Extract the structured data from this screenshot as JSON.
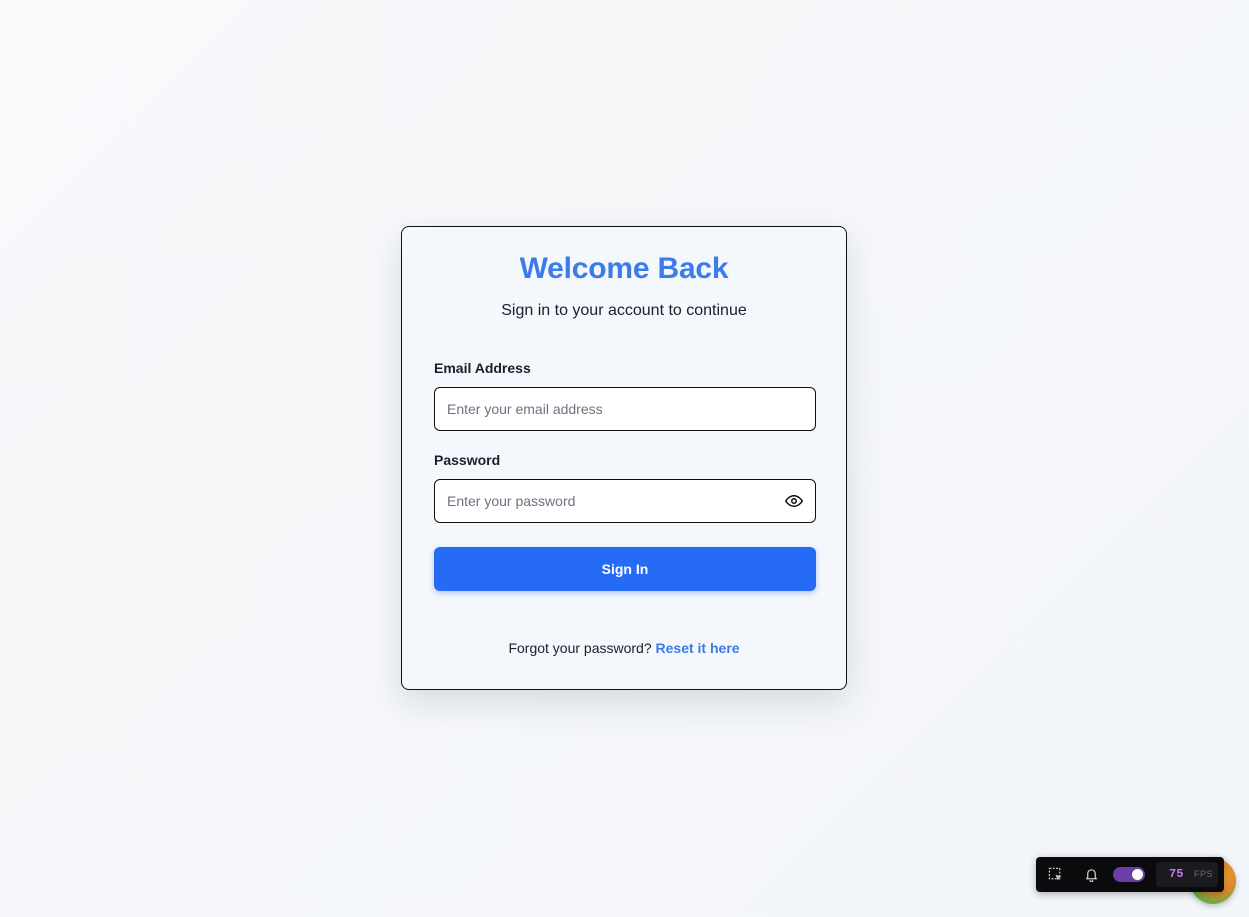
{
  "login": {
    "title": "Welcome Back",
    "subtitle": "Sign in to your account to continue",
    "email": {
      "label": "Email Address",
      "placeholder": "Enter your email address",
      "value": ""
    },
    "password": {
      "label": "Password",
      "placeholder": "Enter your password",
      "value": "",
      "toggle_icon": "eye-icon"
    },
    "submit_label": "Sign In",
    "footer": {
      "text": "Forgot your password?",
      "link_label": "Reset it here"
    }
  },
  "dev_toolbar": {
    "icons": [
      "select-element-icon",
      "bell-icon"
    ],
    "toggle_on": true,
    "fps_value": "75",
    "fps_unit": "FPS"
  },
  "colors": {
    "accent": "#3b7ce8",
    "button": "#256bf5",
    "background": "#f4f6f9",
    "toggle": "#6b3fa8",
    "fps": "#c27cf2"
  }
}
